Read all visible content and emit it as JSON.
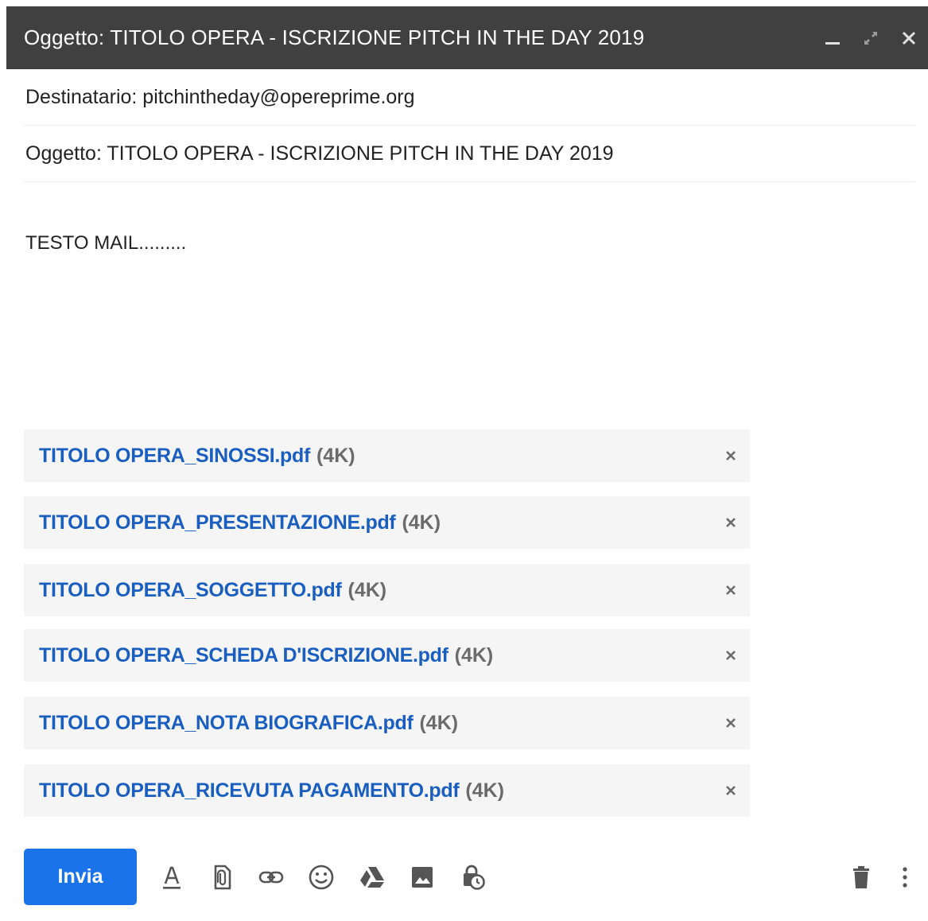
{
  "window": {
    "title": "Oggetto: TITOLO OPERA - ISCRIZIONE PITCH IN THE DAY 2019",
    "controls": [
      "minimize-icon",
      "fullscreen-icon",
      "close-icon"
    ],
    "header_color": "#404040"
  },
  "compose": {
    "to_line": "Destinatario: pitchintheday@opereprime.org",
    "subject_line": "Oggetto: TITOLO OPERA - ISCRIZIONE PITCH IN THE DAY 2019",
    "body": "TESTO MAIL........."
  },
  "attachments": [
    {
      "name": "TITOLO OPERA_SINOSSI.pdf",
      "size": "(4K)"
    },
    {
      "name": "TITOLO OPERA_PRESENTAZIONE.pdf",
      "size": "(4K)"
    },
    {
      "name": "TITOLO OPERA_SOGGETTO.pdf",
      "size": "(4K)"
    },
    {
      "name": "TITOLO OPERA_SCHEDA D'ISCRIZIONE.pdf",
      "size": "(4K)"
    },
    {
      "name": "TITOLO OPERA_NOTA BIOGRAFICA.pdf",
      "size": "(4K)"
    },
    {
      "name": "TITOLO OPERA_RICEVUTA PAGAMENTO.pdf",
      "size": "(4K)"
    }
  ],
  "toolbar": {
    "send_label": "Invia",
    "tools": [
      "formatting-icon",
      "attach-icon",
      "link-icon",
      "emoji-icon",
      "drive-icon",
      "photo-icon",
      "confidential-icon",
      "trash-icon",
      "more-options-icon"
    ],
    "send_color": "#1a73e8",
    "link_color": "#1a5fbf"
  }
}
